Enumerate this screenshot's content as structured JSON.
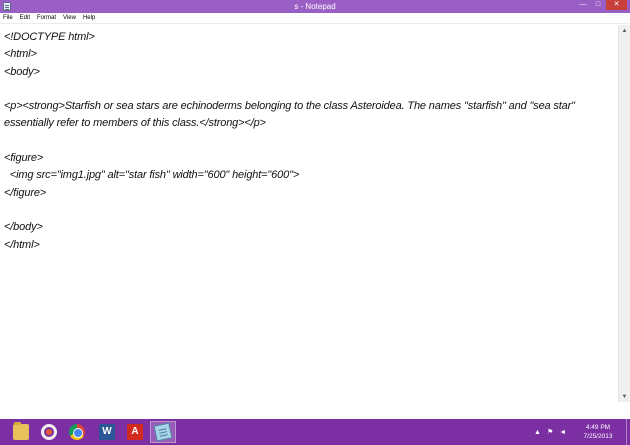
{
  "window": {
    "title": "s - Notepad",
    "minimize_glyph": "—",
    "maximize_glyph": "□",
    "close_glyph": "✕"
  },
  "menu": [
    "File",
    "Edit",
    "Format",
    "View",
    "Help"
  ],
  "editor": {
    "lines": [
      "<!DOCTYPE html>",
      "<html>",
      "<body>",
      "",
      "<p><strong>Starfish or sea stars are echinoderms belonging to the class Asteroidea. The names \"starfish\" and \"sea star\"",
      "essentially refer to members of this class.</strong></p>",
      "",
      "<figure>",
      "  <img src=\"img1.jpg\" alt=\"star fish\" width=\"600\" height=\"600\">",
      "</figure>",
      "",
      "</body>",
      "</html>"
    ]
  },
  "scrollbar": {
    "up_glyph": "▲",
    "down_glyph": "▼"
  },
  "taskbar": {
    "apps": [
      {
        "name": "file-explorer",
        "icon": "folder-icon"
      },
      {
        "name": "ubuntu",
        "icon": "ubuntu-icon"
      },
      {
        "name": "chrome",
        "icon": "chrome-icon"
      },
      {
        "name": "word",
        "icon": "word-icon"
      },
      {
        "name": "acrobat",
        "icon": "acrobat-icon"
      },
      {
        "name": "notepad",
        "icon": "notepad-icon",
        "active": true
      }
    ],
    "tray": {
      "chevron_glyph": "▲",
      "flag_glyph": "⚑",
      "volume_glyph": "◄"
    },
    "clock": {
      "time": "4:49 PM",
      "date": "7/25/2013"
    }
  },
  "colors": {
    "titlebar": "#9a5fc5",
    "taskbar": "#7c2ea3",
    "close_button": "#c7403a"
  }
}
